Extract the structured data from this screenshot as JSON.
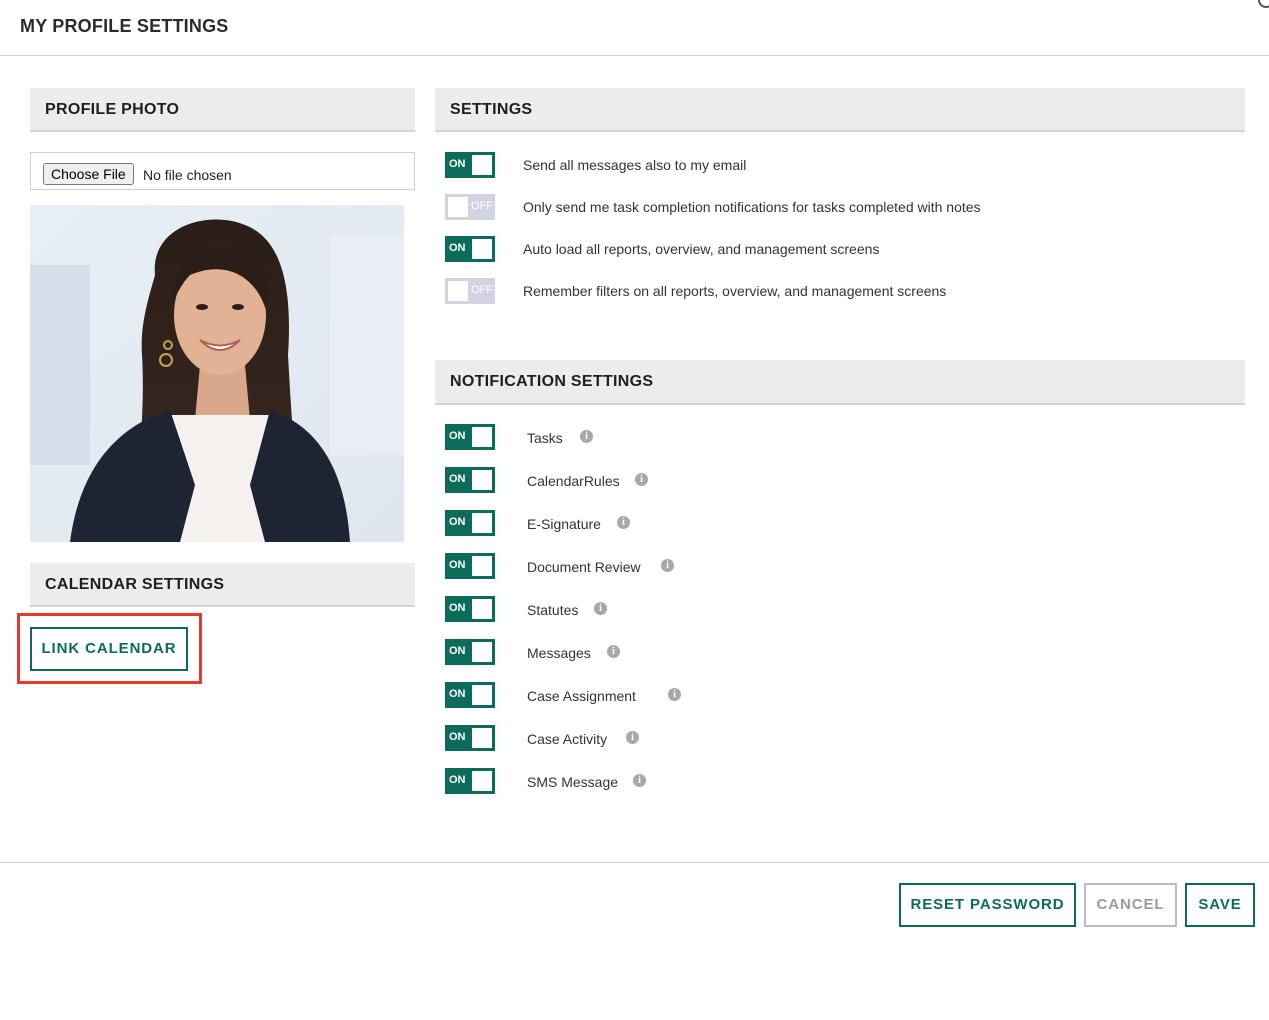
{
  "modal": {
    "title": "MY PROFILE SETTINGS"
  },
  "profile_photo": {
    "heading": "PROFILE PHOTO",
    "choose_file_label": "Choose File",
    "file_status": "No file chosen"
  },
  "calendar": {
    "heading": "CALENDAR SETTINGS",
    "link_label": "LINK CALENDAR"
  },
  "settings": {
    "heading": "SETTINGS",
    "items": [
      {
        "state": "ON",
        "label": "Send all messages also to my email"
      },
      {
        "state": "OFF",
        "label": "Only send me task completion notifications for tasks completed with notes"
      },
      {
        "state": "ON",
        "label": "Auto load all reports, overview, and management screens"
      },
      {
        "state": "OFF",
        "label": "Remember filters on all reports, overview, and management screens"
      }
    ]
  },
  "notifications": {
    "heading": "NOTIFICATION SETTINGS",
    "items": [
      {
        "state": "ON",
        "label": "Tasks"
      },
      {
        "state": "ON",
        "label": "CalendarRules"
      },
      {
        "state": "ON",
        "label": "E-Signature"
      },
      {
        "state": "ON",
        "label": "Document Review"
      },
      {
        "state": "ON",
        "label": "Statutes"
      },
      {
        "state": "ON",
        "label": "Messages"
      },
      {
        "state": "ON",
        "label": "Case Assignment"
      },
      {
        "state": "ON",
        "label": "Case Activity"
      },
      {
        "state": "ON",
        "label": "SMS Message"
      }
    ]
  },
  "footer": {
    "reset_label": "RESET PASSWORD",
    "cancel_label": "CANCEL",
    "save_label": "SAVE"
  },
  "colors": {
    "accent": "#0d6b5c",
    "toggle_off": "#d2d4e4",
    "highlight": "#e8382d",
    "section_bg": "#ececec"
  }
}
